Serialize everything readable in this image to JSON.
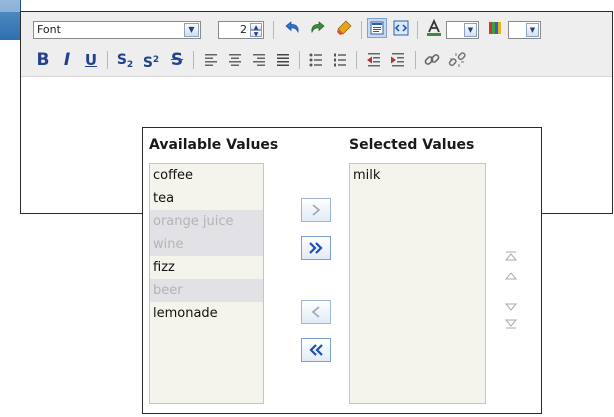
{
  "toolbar": {
    "font_select": {
      "value": "Font"
    },
    "font_size": {
      "value": "2"
    }
  },
  "shuttle": {
    "available": {
      "header": "Available Values",
      "items": [
        {
          "label": "coffee",
          "disabled": false
        },
        {
          "label": "tea",
          "disabled": false
        },
        {
          "label": "orange juice",
          "disabled": true
        },
        {
          "label": "wine",
          "disabled": true
        },
        {
          "label": "fizz",
          "disabled": false
        },
        {
          "label": "beer",
          "disabled": true
        },
        {
          "label": "lemonade",
          "disabled": false
        }
      ]
    },
    "selected": {
      "header": "Selected Values",
      "items": [
        {
          "label": "milk"
        }
      ]
    }
  },
  "icons": [
    "font-dropdown-icon",
    "spin-up-icon",
    "spin-down-icon",
    "undo-icon",
    "redo-icon",
    "eraser-icon",
    "rich-text-mode-icon",
    "source-mode-icon",
    "text-color-icon",
    "background-color-icon",
    "bold-icon",
    "italic-icon",
    "underline-icon",
    "subscript-icon",
    "superscript-icon",
    "strikethrough-icon",
    "align-left-icon",
    "align-center-icon",
    "align-right-icon",
    "justify-icon",
    "bullet-list-icon",
    "numbered-list-icon",
    "outdent-icon",
    "indent-icon",
    "link-icon",
    "unlink-icon",
    "move-icon",
    "move-all-icon",
    "remove-icon",
    "remove-all-icon",
    "move-top-icon",
    "move-up-icon",
    "move-down-icon",
    "move-bottom-icon"
  ],
  "colors": {
    "button_blue": "#1c4fb6",
    "list_bg": "#f4f3ec",
    "disabled_row": "#e1e1e6",
    "toolbar_bg": "#eeeeee"
  }
}
